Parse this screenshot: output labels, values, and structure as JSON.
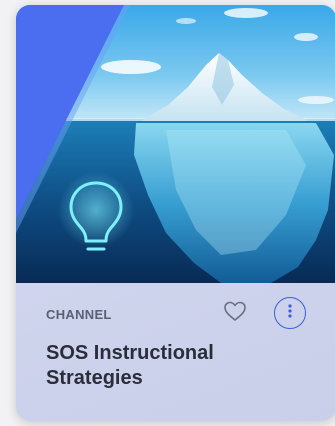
{
  "card": {
    "type_label": "CHANNEL",
    "title": "SOS Instructional Strategies",
    "hero_image": "iceberg-lightbulb-illustration",
    "favorite_icon": "heart-outline-icon",
    "more_icon": "vertical-ellipsis-icon",
    "accent_color": "#3a5fd8"
  }
}
